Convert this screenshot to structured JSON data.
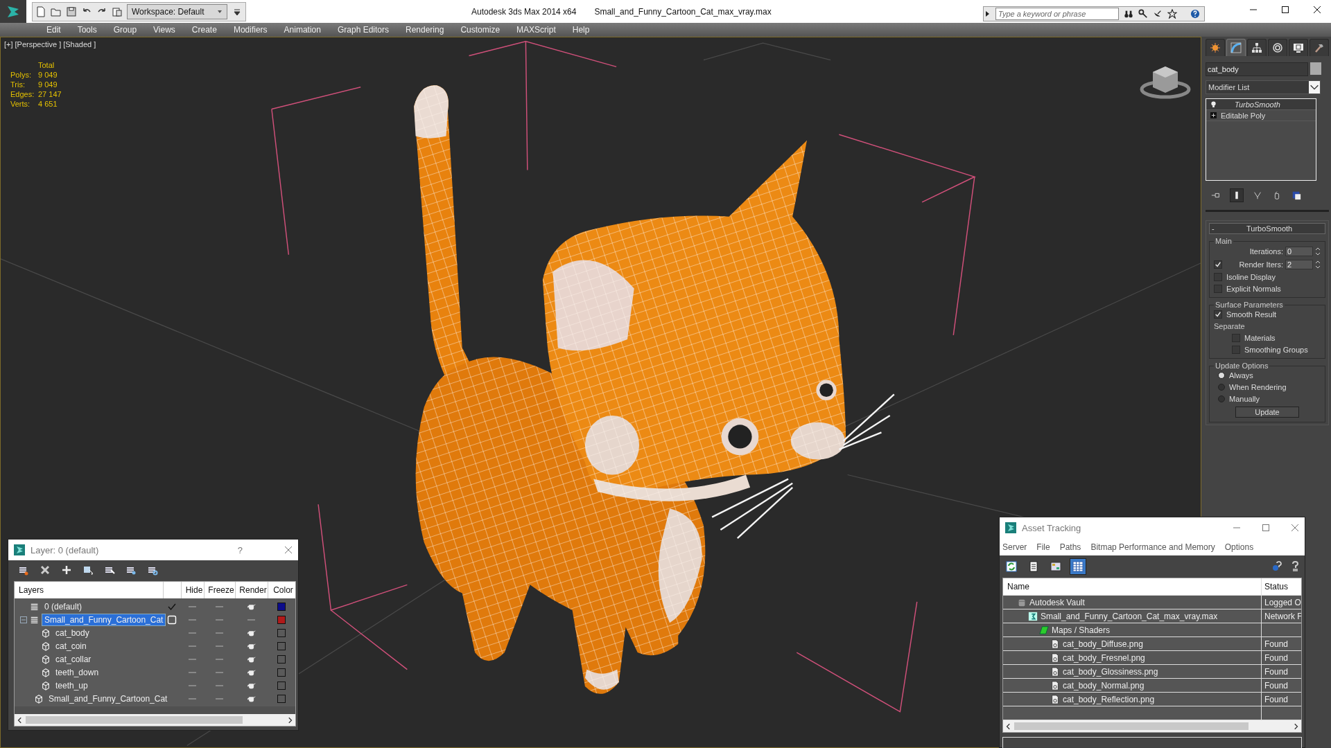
{
  "title_bar": {
    "workspace": "Workspace: Default",
    "app_title": "Autodesk 3ds Max  2014 x64",
    "file_name": "Small_and_Funny_Cartoon_Cat_max_vray.max",
    "search": {
      "placeholder": "Type a keyword or phrase"
    }
  },
  "menu_bar": [
    "Edit",
    "Tools",
    "Group",
    "Views",
    "Create",
    "Modifiers",
    "Animation",
    "Graph Editors",
    "Rendering",
    "Customize",
    "MAXScript",
    "Help"
  ],
  "viewport": {
    "labels": [
      "[+]",
      "[Perspective ]",
      "[Shaded ]"
    ],
    "stats": {
      "header": "Total",
      "rows": [
        {
          "label": "Polys:",
          "value": "9 049"
        },
        {
          "label": "Tris:",
          "value": "9 049"
        },
        {
          "label": "Edges:",
          "value": "27 147"
        },
        {
          "label": "Verts:",
          "value": "4 651"
        }
      ]
    }
  },
  "command_panel": {
    "tabs": [
      {
        "kind": "create",
        "selected": false
      },
      {
        "kind": "modify",
        "selected": true
      },
      {
        "kind": "hierarchy",
        "selected": false
      },
      {
        "kind": "motion",
        "selected": false
      },
      {
        "kind": "display",
        "selected": false
      },
      {
        "kind": "utilities",
        "selected": false
      }
    ],
    "object_name": "cat_body",
    "modifier_list": "Modifier List",
    "modifier_stack": [
      {
        "kind": "modifier",
        "label": "TurboSmooth",
        "selected": true
      },
      {
        "kind": "base",
        "label": "Editable Poly",
        "selected": false
      }
    ],
    "rollout": {
      "collapse": "-",
      "title": "TurboSmooth",
      "groups": [
        {
          "title": "Main",
          "items": [
            {
              "kind": "spinner",
              "label": "Iterations:",
              "value": "0"
            },
            {
              "kind": "check_spinner",
              "label": "Render Iters:",
              "checked": true,
              "value": "2"
            },
            {
              "kind": "checkbox",
              "label": "Isoline Display",
              "checked": false
            },
            {
              "kind": "checkbox",
              "label": "Explicit Normals",
              "checked": false
            }
          ]
        },
        {
          "title": "Surface Parameters",
          "items": [
            {
              "kind": "checkbox",
              "label": "Smooth Result",
              "checked": true
            },
            {
              "kind": "label",
              "label": "Separate",
              "children": [
                {
                  "kind": "checkbox",
                  "label": "Materials",
                  "checked": false
                },
                {
                  "kind": "checkbox",
                  "label": "Smoothing Groups",
                  "checked": false
                }
              ]
            }
          ]
        },
        {
          "title": "Update Options",
          "items": [
            {
              "kind": "radio",
              "label": "Always",
              "selected": true
            },
            {
              "kind": "radio",
              "label": "When Rendering",
              "selected": false
            },
            {
              "kind": "radio",
              "label": "Manually",
              "selected": false
            },
            {
              "kind": "button",
              "label": "Update"
            }
          ]
        }
      ]
    }
  },
  "layer_window": {
    "title": "Layer: 0 (default)",
    "help": "?",
    "columns": [
      "Layers",
      "Hide",
      "Freeze",
      "Render",
      "Color"
    ],
    "rows": [
      {
        "kind": "layer",
        "name": "0 (default)",
        "current": true,
        "selected": false,
        "hidden": false,
        "frozen": false,
        "render": true,
        "color": "#0c0c8a"
      },
      {
        "kind": "layer",
        "name": "Small_and_Funny_Cartoon_Cat",
        "current": false,
        "selected": true,
        "expanded": true,
        "hidden": false,
        "frozen": false,
        "render": false,
        "color": "#b01a1a",
        "children": [
          {
            "kind": "object",
            "name": "cat_body",
            "selected": false,
            "hidden": false,
            "frozen": false,
            "render": true,
            "color": "#5a5a5a"
          },
          {
            "kind": "object",
            "name": "cat_coin",
            "selected": false,
            "hidden": false,
            "frozen": false,
            "render": true,
            "color": "#5a5a5a"
          },
          {
            "kind": "object",
            "name": "cat_collar",
            "selected": false,
            "hidden": false,
            "frozen": false,
            "render": true,
            "color": "#5a5a5a"
          },
          {
            "kind": "object",
            "name": "teeth_down",
            "selected": false,
            "hidden": false,
            "frozen": false,
            "render": true,
            "color": "#5a5a5a"
          },
          {
            "kind": "object",
            "name": "teeth_up",
            "selected": false,
            "hidden": false,
            "frozen": false,
            "render": true,
            "color": "#5a5a5a"
          },
          {
            "kind": "object",
            "name": "Small_and_Funny_Cartoon_Cat",
            "selected": false,
            "hidden": false,
            "frozen": false,
            "render": true,
            "color": "#5a5a5a"
          }
        ]
      }
    ]
  },
  "asset_tracking": {
    "title": "Asset Tracking",
    "menu": [
      "Server",
      "File",
      "Paths",
      "Bitmap Performance and Memory",
      "Options"
    ],
    "toolbar": [
      {
        "kind": "refresh",
        "selected": false
      },
      {
        "kind": "list",
        "selected": false
      },
      {
        "kind": "thumbnails",
        "selected": false
      },
      {
        "kind": "table",
        "selected": true
      }
    ],
    "columns": [
      "Name",
      "Status"
    ],
    "rows": [
      {
        "kind": "vault",
        "name": "Autodesk Vault",
        "status": "Logged O",
        "children": [
          {
            "kind": "scene",
            "name": "Small_and_Funny_Cartoon_Cat_max_vray.max",
            "status": "Network F",
            "children": [
              {
                "kind": "folder",
                "name": "Maps / Shaders",
                "children": [
                  {
                    "kind": "bitmap",
                    "name": "cat_body_Diffuse.png",
                    "status": "Found"
                  },
                  {
                    "kind": "bitmap",
                    "name": "cat_body_Fresnel.png",
                    "status": "Found"
                  },
                  {
                    "kind": "bitmap",
                    "name": "cat_body_Glossiness.png",
                    "status": "Found"
                  },
                  {
                    "kind": "bitmap",
                    "name": "cat_body_Normal.png",
                    "status": "Found"
                  },
                  {
                    "kind": "bitmap",
                    "name": "cat_body_Reflection.png",
                    "status": "Found"
                  }
                ]
              }
            ]
          }
        ]
      }
    ]
  }
}
